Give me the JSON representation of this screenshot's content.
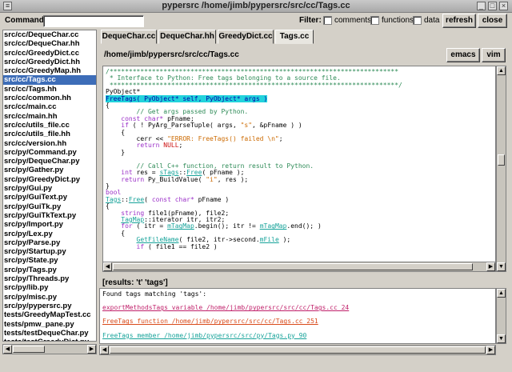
{
  "window": {
    "title": "pypersrc  /home/jimb/pypersrc/src/cc/Tags.cc"
  },
  "toolbar": {
    "command_label": "Command:",
    "command_value": "",
    "filter_label": "Filter:",
    "filter_comments": "comments",
    "filter_functions": "functions",
    "filter_data": "data",
    "refresh_label": "refresh",
    "close_label": "close"
  },
  "files": [
    "src/cc/DequeChar.cc",
    "src/cc/DequeChar.hh",
    "src/cc/GreedyDict.cc",
    "src/cc/GreedyDict.hh",
    "src/cc/GreedyMap.hh",
    "src/cc/Tags.cc",
    "src/cc/Tags.hh",
    "src/cc/common.hh",
    "src/cc/main.cc",
    "src/cc/main.hh",
    "src/cc/utils_file.cc",
    "src/cc/utils_file.hh",
    "src/cc/version.hh",
    "src/py/Command.py",
    "src/py/DequeChar.py",
    "src/py/Gather.py",
    "src/py/GreedyDict.py",
    "src/py/Gui.py",
    "src/py/GuiText.py",
    "src/py/GuiTk.py",
    "src/py/GuiTkText.py",
    "src/py/Import.py",
    "src/py/Lex.py",
    "src/py/Parse.py",
    "src/py/Startup.py",
    "src/py/State.py",
    "src/py/Tags.py",
    "src/py/Threads.py",
    "src/py/lib.py",
    "src/py/misc.py",
    "src/py/pypersrc.py",
    "tests/GreedyMapTest.cc",
    "tests/pmw_pane.py",
    "tests/testDequeChar.py",
    "tests/testGreedyDict.py"
  ],
  "selected_file": "src/cc/Tags.cc",
  "tabs": [
    "DequeChar.cc",
    "DequeChar.hh",
    "GreedyDict.cc",
    "Tags.cc"
  ],
  "active_tab": "Tags.cc",
  "path": "/home/jimb/pypersrc/src/cc/Tags.cc",
  "editor_buttons": {
    "emacs": "emacs",
    "vim": "vim"
  },
  "code": {
    "l1": "/***************************************************************************",
    "l2": " * Interface to Python: Free tags belonging to a source file.",
    "l3": " ***************************************************************************/",
    "l4": "PyObject*",
    "l5_hl": "FreeTags( PyObject* self, PyObject* args )",
    "l6": "{",
    "l7": "    // Get args passed by Python.",
    "l8_kw": "const char*",
    "l8_rest": " pFname;",
    "l9_kw": "if",
    "l9_a": " ( ! PyArg_ParseTuple( args, ",
    "l9_str": "\"s\"",
    "l9_b": ", &pFname ) )",
    "l10": "    {",
    "l11_a": "        cerr << ",
    "l11_str": "\"ERROR: FreeTags() failed \\n\"",
    "l11_b": ";",
    "l12_kw": "return",
    "l12_red": "NULL",
    "l12_b": ";",
    "l13": "    }",
    "l14": "    // Call C++ function, return result to Python.",
    "l15_kw": "int",
    "l15_a": " res = ",
    "l15_link1": "sTags",
    "l15_b": "::",
    "l15_link2": "Free",
    "l15_c": "( pFname );",
    "l16_kw": "return",
    "l16_a": " Py_BuildValue( ",
    "l16_str": "\"i\"",
    "l16_b": ", res );",
    "l17": "}",
    "l18": "bool",
    "l19_link1": "Tags",
    "l19_a": "::",
    "l19_link2": "Free",
    "l19_b": "( ",
    "l19_kw": "const char*",
    "l19_c": " pFname )",
    "l20": "{",
    "l21_kw": "string",
    "l21_a": " file1(pFname), file2;",
    "l22_link": "TagMap",
    "l22_a": "::iterator itr, itr2;",
    "l23_kw": "for",
    "l23_a": " ( itr = ",
    "l23_link1": "mTagMap",
    "l23_b": ".begin(); itr != ",
    "l23_link2": "mTagMap",
    "l23_c": ".end(); )",
    "l24": "    {",
    "l25_link1": "GetFileName",
    "l25_a": "( file2, itr->second.",
    "l25_link2": "mFile",
    "l25_b": " );",
    "l26_kw": "if",
    "l26_a": " ( file1 == file2 )"
  },
  "results": {
    "label": "[results: 't' 'tags']",
    "header": "Found tags matching 'tags':",
    "r1": "exportMethodsTags variable /home/jimb/pypersrc/src/cc/Tags.cc 24",
    "r2": "FreeTags function /home/jimb/pypersrc/src/cc/Tags.cc 251",
    "r3": "FreeTags member /home/jimb/pypersrc/src/py/Tags.py 90"
  }
}
